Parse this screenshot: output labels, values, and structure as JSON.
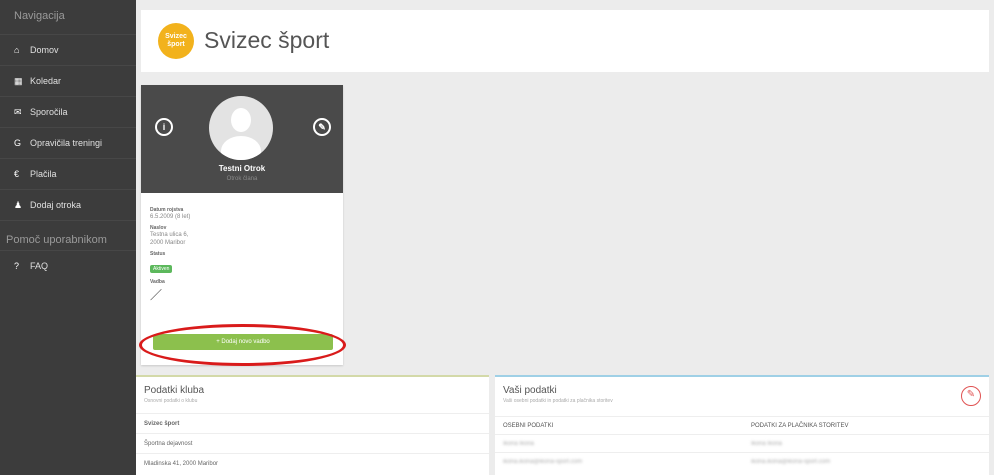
{
  "sidebar": {
    "header": "Navigacija",
    "items": [
      {
        "icon": "home-icon",
        "glyph": "⌂",
        "label": "Domov"
      },
      {
        "icon": "calendar-icon",
        "glyph": "▦",
        "label": "Koledar"
      },
      {
        "icon": "messages-icon",
        "glyph": "✉",
        "label": "Sporočila"
      },
      {
        "icon": "excuse-icon",
        "glyph": "G",
        "label": "Opravičila treningi"
      },
      {
        "icon": "euro-icon",
        "glyph": "€",
        "label": "Plačila"
      },
      {
        "icon": "user-add-icon",
        "glyph": "♟",
        "label": "Dodaj otroka"
      }
    ],
    "section2": "Pomoč uporabnikom",
    "faq": {
      "icon": "question-icon",
      "glyph": "?",
      "label": "FAQ"
    }
  },
  "header": {
    "logo_text": "Svizec šport",
    "brand": "Svizec šport"
  },
  "profile": {
    "name": "Testni Otrok",
    "subtitle": "Otrok člana",
    "birth_label": "Datum rojstva",
    "birth_value": "6.5.2009 (8 let)",
    "address_label": "Naslov",
    "address_line1": "Testna ulica 6,",
    "address_line2": "2000 Maribor",
    "status_label": "Status",
    "status_value": "Aktiven",
    "groups_label": "Vadba",
    "add_button": "+ Dodaj novo vadbo"
  },
  "club": {
    "title": "Podatki kluba",
    "subtitle": "Osnovni podatki o klubu",
    "rows": [
      "Svizec šport",
      "Športna dejavnost",
      "Mladinska 41, 2000 Maribor"
    ]
  },
  "yours": {
    "title": "Vaši podatki",
    "subtitle": "Vaši osebni podatki in podatki za plačnika storitev",
    "col1": "OSEBNI PODATKI",
    "col2": "PODATKI ZA PLAČNIKA STORITEV",
    "row1": [
      "Ikona Ikona",
      "Ikona Ikona"
    ],
    "row2": [
      "ikona.ikona@ikona-sport.com",
      "ikona.ikona@ikona-sport.com"
    ]
  },
  "colors": {
    "sidebar": "#3c3c3c",
    "accent_green": "#8cc04d",
    "logo_yellow": "#f2b21c",
    "highlight_red": "#d91b1b"
  }
}
